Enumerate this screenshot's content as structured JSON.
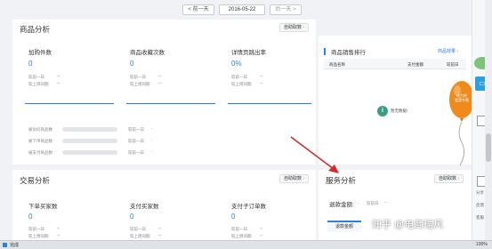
{
  "datebar": {
    "prev_label": "< 前一天",
    "date": "2016-05-22",
    "next_label": "后一天 >"
  },
  "product_analysis": {
    "title": "商品分析",
    "custom_btn": "自助取数",
    "metrics": [
      {
        "label": "加购件数",
        "value": "0",
        "cmp1": "较前一日",
        "cmp2": "较上周同期"
      },
      {
        "label": "商品收藏次数",
        "value": "0",
        "cmp1": "较前一日",
        "cmp2": "较上周同期"
      },
      {
        "label": "详情页跳出率",
        "value": "0%",
        "cmp1": "较前一日",
        "cmp2": "较上周同期"
      }
    ],
    "bars": [
      {
        "label": "被访问商品数",
        "cmp": "较前一日"
      },
      {
        "label": "被下单商品数",
        "cmp": "较前一日"
      },
      {
        "label": "被支付商品数",
        "cmp": "较前一日"
      }
    ]
  },
  "sales_ranking": {
    "title": "商品销售排行",
    "link": "商品效果",
    "columns": [
      "商品名称",
      "支付金额",
      "较前日"
    ],
    "empty_text": "暂无数据!"
  },
  "trade_analysis": {
    "title": "交易分析",
    "custom_btn": "自助取数",
    "metrics": [
      {
        "label": "下单买家数",
        "value": "0",
        "cmp1": "较前一日",
        "cmp2": "较上周同期"
      },
      {
        "label": "支付买家数",
        "value": "0",
        "cmp1": "较前一日",
        "cmp2": "较上周同期"
      },
      {
        "label": "支付子订单数",
        "value": "0",
        "cmp1": "较前一日",
        "cmp2": "较上周同期"
      }
    ]
  },
  "service_analysis": {
    "title": "服务分析",
    "custom_btn": "自助取数",
    "refund_label": "退款金额:",
    "refund_cmp": "较前日",
    "sub_tab": "退款金额"
  },
  "balloon": {
    "text_line1": "给力吧",
    "text_line2": "看我专属"
  },
  "side": {
    "items": [
      "分享",
      "反馈",
      "客服"
    ]
  },
  "status": {
    "left": "完成",
    "zoom": "100%"
  },
  "watermark": "知乎 @电商瑞风"
}
